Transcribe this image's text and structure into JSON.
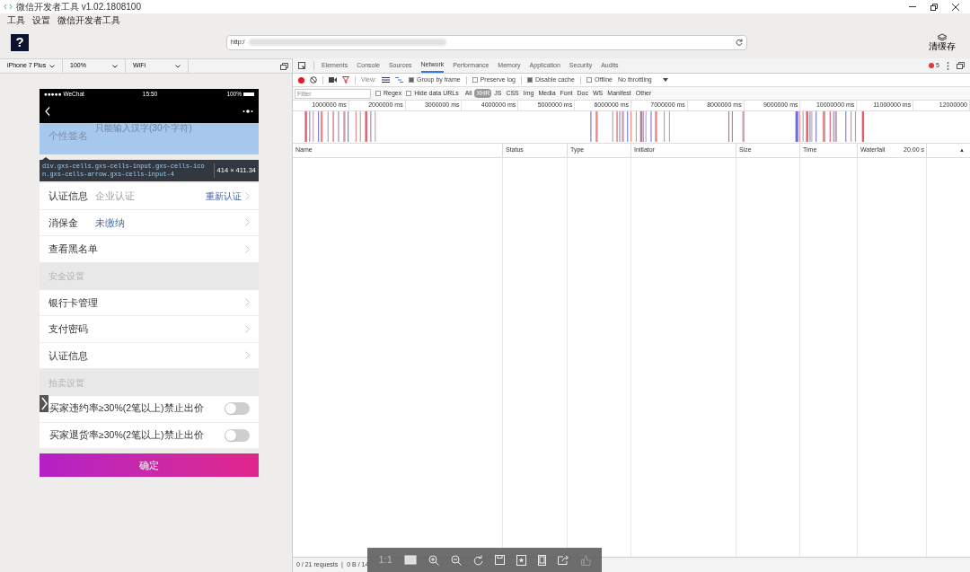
{
  "window": {
    "title": "微信开发者工具 v1.02.1808100"
  },
  "menu": [
    "工具",
    "设置",
    "微信开发者工具"
  ],
  "toolbar": {
    "help": "?",
    "url": "http:/",
    "clear_cache": "清缓存"
  },
  "device_bar": {
    "device": "iPhone 7 Plus",
    "zoom": "100%",
    "network": "WiFi"
  },
  "phone": {
    "status": {
      "carrier": "●●●●● WeChat",
      "time": "15:50",
      "battery": "100%"
    },
    "highlight_row": {
      "label": "个性签名",
      "placeholder": "只能输入汉字(30个字符)"
    },
    "inspect_tooltip": {
      "selector": "div.gxs-cells.gxs-cells-input.gxs-cells-icon.gxs-cells-arrow.gxs-cells-input-4",
      "size": "414 × 411.34"
    },
    "rows": [
      {
        "kind": "cell",
        "label": "认证信息",
        "value": "企业认证",
        "color": "#9e9e9e",
        "action": "重新认证"
      },
      {
        "kind": "cell",
        "label": "消保金",
        "value": "未缴纳",
        "color": "#4a6fb0"
      },
      {
        "kind": "cell",
        "label": "查看黑名单"
      },
      {
        "kind": "section",
        "label": "安全设置"
      },
      {
        "kind": "cell",
        "label": "银行卡管理"
      },
      {
        "kind": "cell",
        "label": "支付密码"
      },
      {
        "kind": "cell",
        "label": "认证信息"
      },
      {
        "kind": "section",
        "label": "拍卖设置"
      },
      {
        "kind": "toggle",
        "label": "买家违约率≥30%(2笔以上)禁止出价",
        "on": false
      },
      {
        "kind": "toggle",
        "label": "买家退货率≥30%(2笔以上)禁止出价",
        "on": false
      }
    ],
    "confirm": "确定"
  },
  "devtools": {
    "tabs": [
      {
        "label": "Elements",
        "selected": false
      },
      {
        "label": "Console",
        "selected": false
      },
      {
        "label": "Sources",
        "selected": false
      },
      {
        "label": "Network",
        "selected": true
      },
      {
        "label": "Performance",
        "selected": false
      },
      {
        "label": "Memory",
        "selected": false
      },
      {
        "label": "Application",
        "selected": false
      },
      {
        "label": "Security",
        "selected": false
      },
      {
        "label": "Audits",
        "selected": false
      }
    ],
    "error_count": "5",
    "options": {
      "view": "View:",
      "checks": [
        {
          "label": "Group by frame",
          "checked": true
        },
        {
          "label": "Preserve log",
          "checked": false
        },
        {
          "label": "Disable cache",
          "checked": true
        },
        {
          "label": "Offline",
          "checked": false
        }
      ],
      "throttling": "No throttling"
    },
    "filter": {
      "placeholder": "Filter",
      "checks": [
        {
          "label": "Regex",
          "checked": false
        },
        {
          "label": "Hide data URLs",
          "checked": false
        }
      ],
      "types": [
        {
          "label": "All",
          "selected": false
        },
        {
          "label": "XHR",
          "selected": true
        },
        {
          "label": "JS",
          "selected": false
        },
        {
          "label": "CSS",
          "selected": false
        },
        {
          "label": "Img",
          "selected": false
        },
        {
          "label": "Media",
          "selected": false
        },
        {
          "label": "Font",
          "selected": false
        },
        {
          "label": "Doc",
          "selected": false
        },
        {
          "label": "WS",
          "selected": false
        },
        {
          "label": "Manifest",
          "selected": false
        },
        {
          "label": "Other",
          "selected": false
        }
      ]
    },
    "timeline_ticks": [
      "1000000 ms",
      "2000000 ms",
      "3000000 ms",
      "4000000 ms",
      "5000000 ms",
      "6000000 ms",
      "7000000 ms",
      "8000000 ms",
      "9000000 ms",
      "10000000 ms",
      "11000000 ms",
      "12000000"
    ],
    "columns": [
      "Name",
      "Status",
      "Type",
      "Initiator",
      "Size",
      "Time",
      "Waterfall"
    ],
    "waterfall_scale": "20.00 s",
    "sort": "▲",
    "status_bar": "0 / 21 requests ❘ 0 B / 14"
  },
  "viewer_toolbar": {
    "zoom_label": "1:1"
  }
}
